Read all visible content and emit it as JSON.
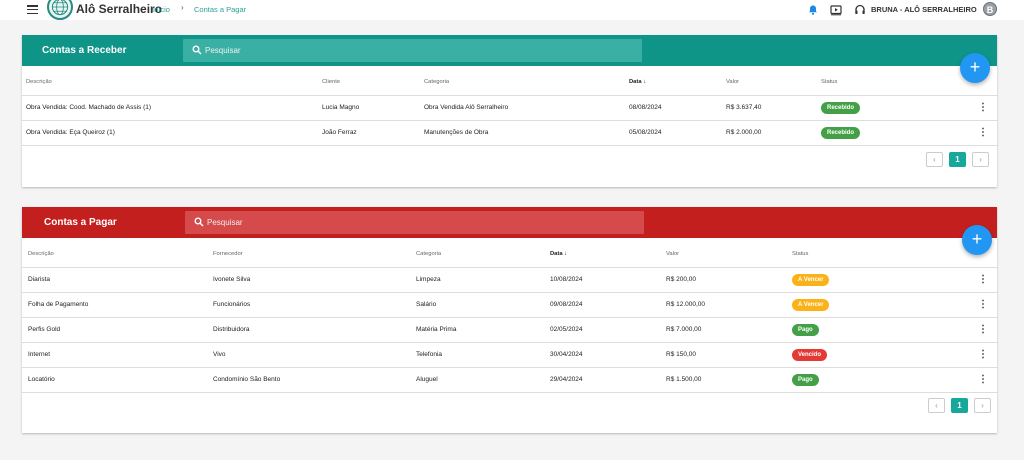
{
  "app": {
    "brand": "Alô Serralheiro",
    "breadcrumb": {
      "home": "Início",
      "sep": "›",
      "current": "Contas a Pagar"
    },
    "user": {
      "name": "BRUNA - ALÔ SERRALHEIRO",
      "initial": "B"
    }
  },
  "colors": {
    "receber": "#0f9588",
    "pagar": "#c41f1f",
    "fab": "#2196f3",
    "pg_active": "#16a89a"
  },
  "receber": {
    "title": "Contas a Receber",
    "search_placeholder": "Pesquisar",
    "headers": {
      "c1": "Descrição",
      "c2": "Cliente",
      "c3": "Categoria",
      "c4": "Data",
      "c5": "Valor",
      "c6": "Status"
    },
    "rows": [
      {
        "c1": "Obra Vendida: Cood. Machado de Assis (1)",
        "c2": "Lucia Magno",
        "c3": "Obra Vendida Alô Serralheiro",
        "c4": "08/08/2024",
        "c5": "R$ 3.637,40",
        "status": "Recebido",
        "status_color": "#43a047"
      },
      {
        "c1": "Obra Vendida: Eça Queiroz (1)",
        "c2": "João Ferraz",
        "c3": "Manutenções de Obra",
        "c4": "05/08/2024",
        "c5": "R$ 2.000,00",
        "status": "Recebido",
        "status_color": "#43a047"
      }
    ],
    "page": "1"
  },
  "pagar": {
    "title": "Contas a Pagar",
    "search_placeholder": "Pesquisar",
    "headers": {
      "c1": "Descrição",
      "c2": "Fornecedor",
      "c3": "Categoria",
      "c4": "Data",
      "c5": "Valor",
      "c6": "Status"
    },
    "rows": [
      {
        "c1": "Diarista",
        "c2": "Ivonete Silva",
        "c3": "Limpeza",
        "c4": "10/08/2024",
        "c5": "R$ 200,00",
        "status": "A Vencer",
        "status_color": "#fbb218"
      },
      {
        "c1": "Folha de Pagamento",
        "c2": "Funcionários",
        "c3": "Salário",
        "c4": "09/08/2024",
        "c5": "R$ 12.000,00",
        "status": "A Vencer",
        "status_color": "#fbb218"
      },
      {
        "c1": "Perfis Gold",
        "c2": "Distribuidora",
        "c3": "Matéria Prima",
        "c4": "02/05/2024",
        "c5": "R$ 7.000,00",
        "status": "Pago",
        "status_color": "#43a047"
      },
      {
        "c1": "Internet",
        "c2": "Vivo",
        "c3": "Telefonia",
        "c4": "30/04/2024",
        "c5": "R$ 150,00",
        "status": "Vencido",
        "status_color": "#e53935"
      },
      {
        "c1": "Locatório",
        "c2": "Condomínio São Bento",
        "c3": "Aluguel",
        "c4": "29/04/2024",
        "c5": "R$ 1.500,00",
        "status": "Pago",
        "status_color": "#43a047"
      }
    ],
    "page": "1"
  }
}
